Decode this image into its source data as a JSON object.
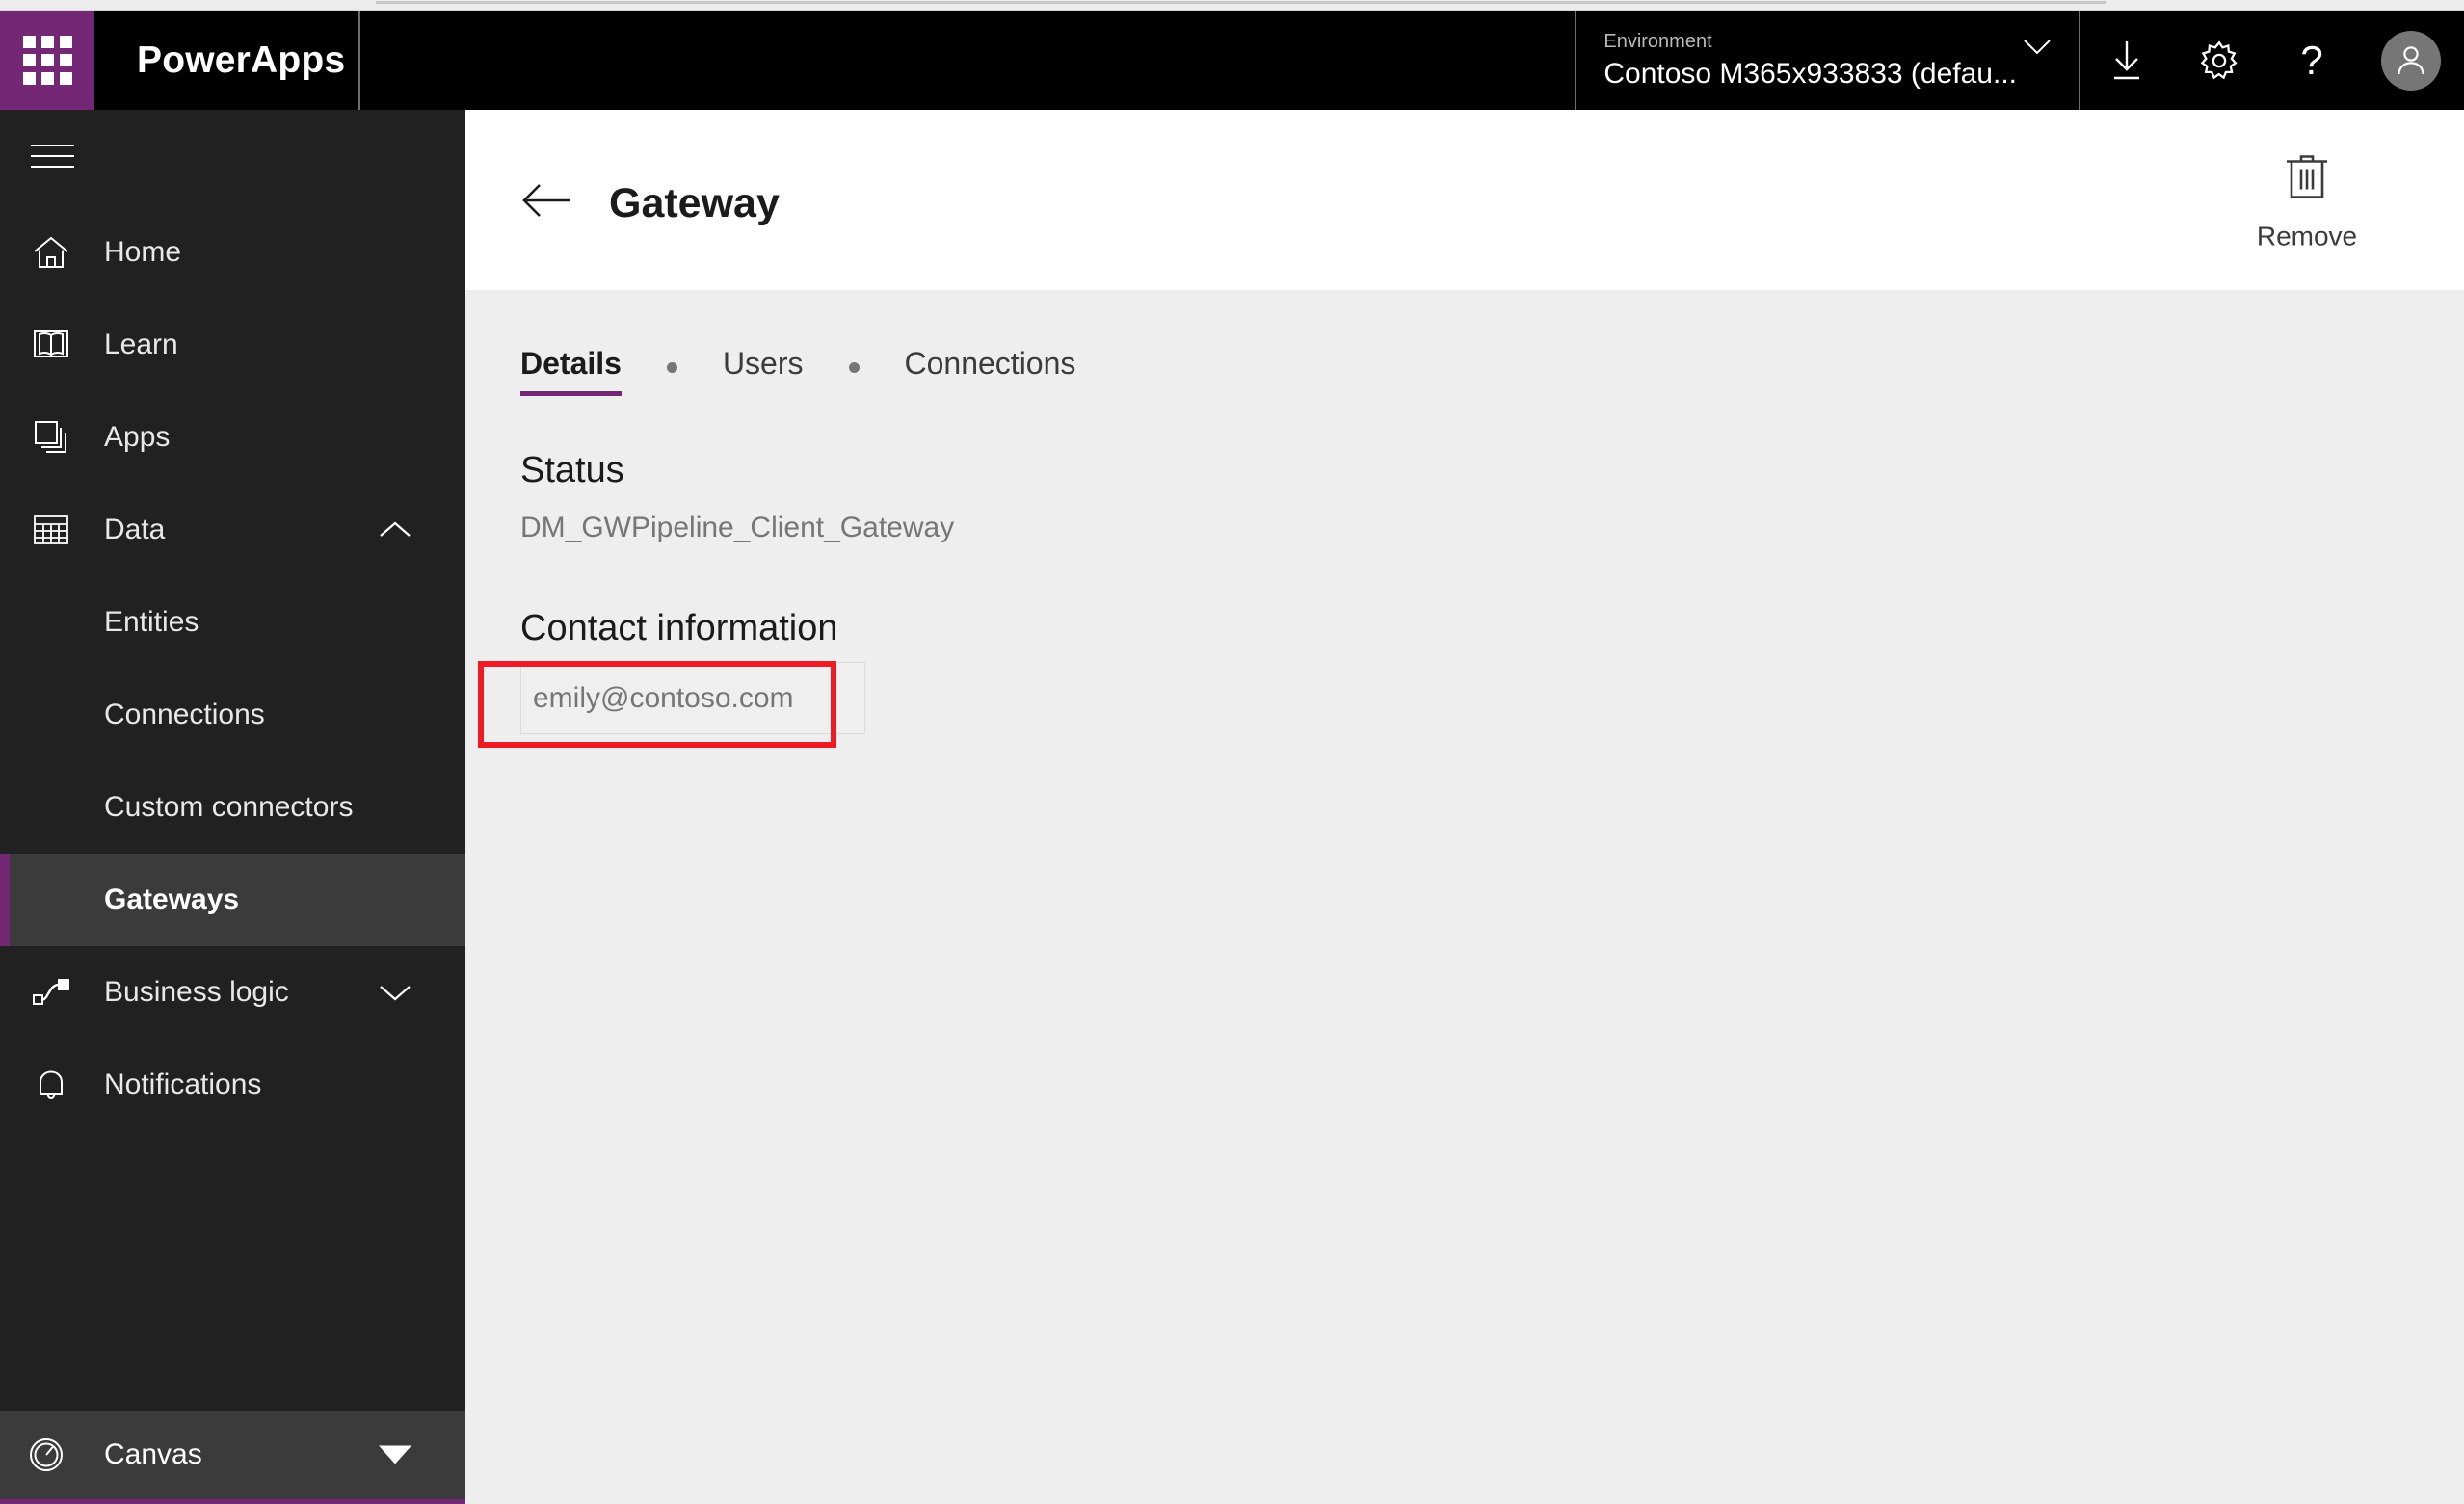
{
  "header": {
    "waffle_icon": "app-launcher-waffle-icon",
    "brand": "PowerApps",
    "environment": {
      "label": "Environment",
      "value": "Contoso M365x933833 (defau...",
      "chevron_icon": "chevron-down-icon"
    },
    "actions": [
      {
        "name": "download-button",
        "icon": "download-icon"
      },
      {
        "name": "settings-button",
        "icon": "gear-icon"
      },
      {
        "name": "help-button",
        "icon": "question-mark-icon",
        "glyph": "?"
      },
      {
        "name": "account-button",
        "icon": "user-avatar-icon"
      }
    ]
  },
  "sidebar": {
    "menu_toggle": "hamburger-menu-icon",
    "items": [
      {
        "label": "Home",
        "icon": "home-icon",
        "type": "item"
      },
      {
        "label": "Learn",
        "icon": "book-icon",
        "type": "item"
      },
      {
        "label": "Apps",
        "icon": "apps-stack-icon",
        "type": "item"
      },
      {
        "label": "Data",
        "icon": "table-grid-icon",
        "type": "group",
        "expanded": true,
        "chevron": "chevron-up-icon"
      },
      {
        "label": "Entities",
        "type": "sub"
      },
      {
        "label": "Connections",
        "type": "sub"
      },
      {
        "label": "Custom connectors",
        "type": "sub"
      },
      {
        "label": "Gateways",
        "type": "sub",
        "active": true
      },
      {
        "label": "Business logic",
        "icon": "flow-branch-icon",
        "type": "group",
        "expanded": false,
        "chevron": "chevron-down-icon"
      },
      {
        "label": "Notifications",
        "icon": "bell-icon",
        "type": "item"
      }
    ],
    "footer": {
      "label": "Canvas",
      "icon": "gauge-icon",
      "caret_icon": "caret-down-icon"
    }
  },
  "page": {
    "back_icon": "back-arrow-icon",
    "title": "Gateway",
    "remove": {
      "label": "Remove",
      "icon": "trash-icon"
    },
    "tabs": [
      {
        "label": "Details",
        "active": true
      },
      {
        "label": "Users",
        "active": false
      },
      {
        "label": "Connections",
        "active": false
      }
    ],
    "status": {
      "heading": "Status",
      "value": "DM_GWPipeline_Client_Gateway"
    },
    "contact": {
      "heading": "Contact information",
      "value": "emily@contoso.com"
    }
  },
  "colors": {
    "brand_purple": "#742774",
    "header_black": "#000000",
    "sidebar_dark": "#212121",
    "sidebar_active": "#3b3b3b",
    "content_bg": "#eeeeee",
    "annotation_red": "#ee1b24",
    "muted_text": "#767676"
  }
}
